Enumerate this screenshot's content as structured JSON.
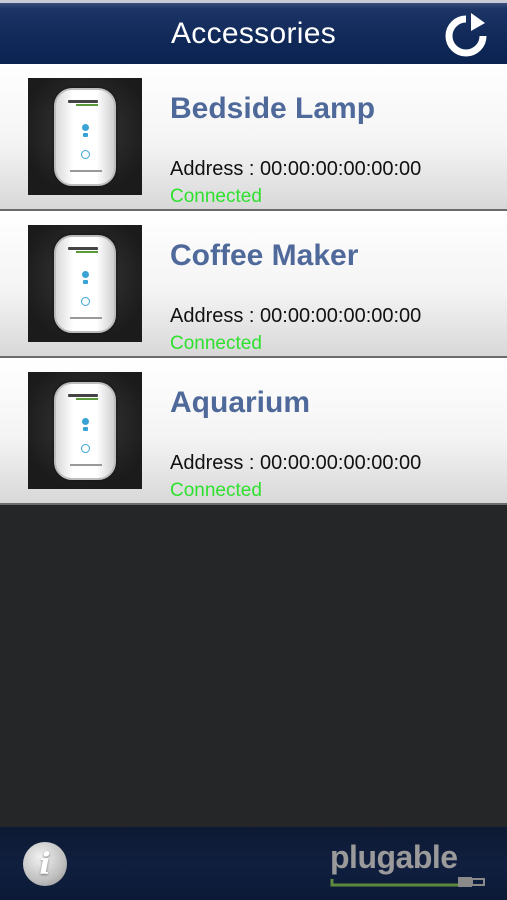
{
  "header": {
    "title": "Accessories",
    "refresh_icon": "refresh-icon"
  },
  "accessories": [
    {
      "name": "Bedside Lamp",
      "address": "Address : 00:00:00:00:00:00",
      "status": "Connected"
    },
    {
      "name": "Coffee Maker",
      "address": "Address : 00:00:00:00:00:00",
      "status": "Connected"
    },
    {
      "name": "Aquarium",
      "address": "Address : 00:00:00:00:00:00",
      "status": "Connected"
    }
  ],
  "device_image_label": "plugable",
  "footer": {
    "info_icon": "info-icon",
    "info_glyph": "i",
    "brand": "plugable"
  },
  "colors": {
    "header_bg": "#0f2857",
    "name_text": "#4f6a9a",
    "status_connected": "#2fe02f",
    "background": "#252628",
    "footer_bg": "#101f3f"
  }
}
